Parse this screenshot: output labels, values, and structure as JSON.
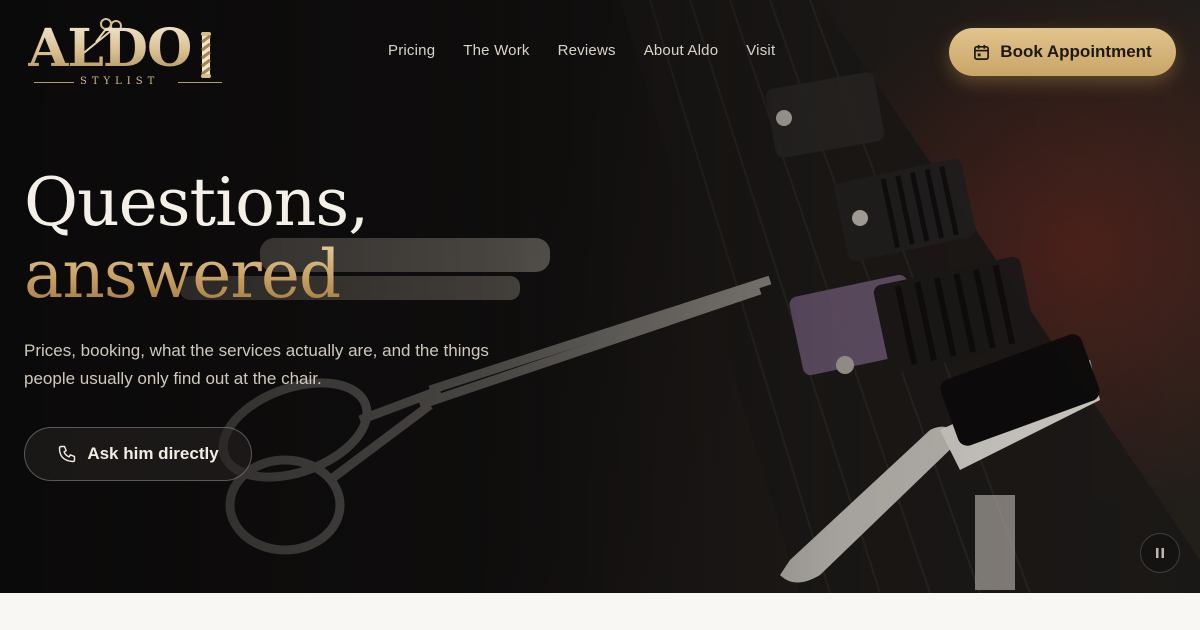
{
  "brand": {
    "wordmark": "ALDO",
    "tagline": "STYLIST",
    "logo_icons": [
      "scissors-icon",
      "barber-pole-icon"
    ]
  },
  "nav": {
    "items": [
      {
        "label": "Pricing"
      },
      {
        "label": "The Work"
      },
      {
        "label": "Reviews"
      },
      {
        "label": "About Aldo"
      },
      {
        "label": "Visit"
      }
    ]
  },
  "cta": {
    "book_label": "Book Appointment",
    "book_icon": "calendar-icon"
  },
  "hero": {
    "title_line1": "Questions,",
    "title_line2": "answered",
    "lead": "Prices, booking, what the services actually are, and the things people usually only find out at the chair.",
    "ask_label": "Ask him directly",
    "ask_icon": "phone-icon",
    "media_control_icon": "pause-icon",
    "background": "barber tools (scissors, clipper guards, brush) on dark surface"
  },
  "colors": {
    "gold_light": "#e2c48e",
    "gold_dark": "#c9a566",
    "hero_bg": "#141211",
    "text_light": "#f4f0e8",
    "page_bg": "#f8f7f3"
  }
}
